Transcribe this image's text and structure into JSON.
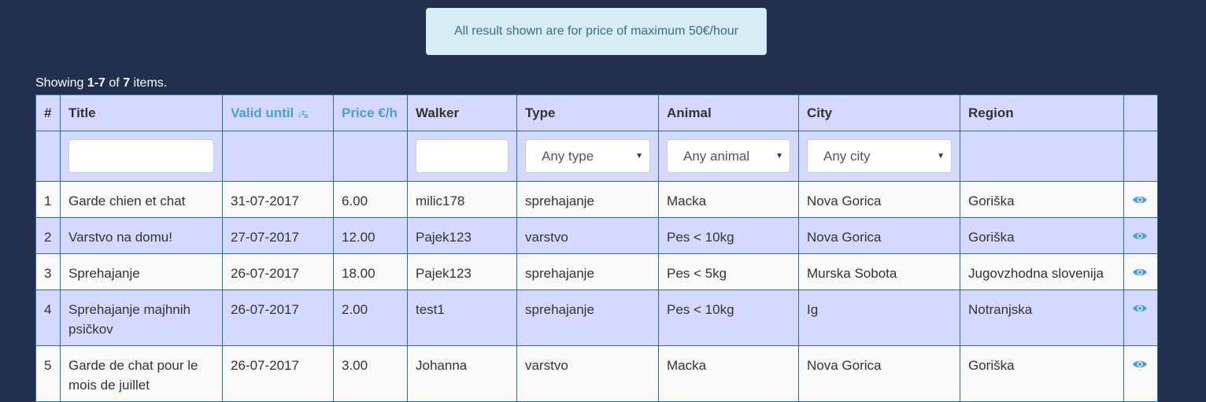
{
  "alert": {
    "text": "All result shown are for price of maximum 50€/hour"
  },
  "summary": {
    "prefix": "Showing ",
    "range": "1-7",
    "middle": " of ",
    "total": "7",
    "suffix": " items."
  },
  "columns": {
    "num": "#",
    "title": "Title",
    "valid_until": "Valid until",
    "price": "Price €/h",
    "walker": "Walker",
    "type": "Type",
    "animal": "Animal",
    "city": "City",
    "region": "Region"
  },
  "sort_icon": "sort-alpha-desc-icon",
  "filters": {
    "title_value": "",
    "walker_value": "",
    "type_selected": "Any type",
    "animal_selected": "Any animal",
    "city_selected": "Any city"
  },
  "rows": [
    {
      "num": "1",
      "title": "Garde chien et chat",
      "valid_until": "31-07-2017",
      "price": "6.00",
      "walker": "milic178",
      "type": "sprehajanje",
      "animal": "Macka",
      "city": "Nova Gorica",
      "region": "Goriška"
    },
    {
      "num": "2",
      "title": "Varstvo na domu!",
      "valid_until": "27-07-2017",
      "price": "12.00",
      "walker": "Pajek123",
      "type": "varstvo",
      "animal": "Pes < 10kg",
      "city": "Nova Gorica",
      "region": "Goriška"
    },
    {
      "num": "3",
      "title": "Sprehajanje",
      "valid_until": "26-07-2017",
      "price": "18.00",
      "walker": "Pajek123",
      "type": "sprehajanje",
      "animal": "Pes < 5kg",
      "city": "Murska Sobota",
      "region": "Jugovzhodna slovenija"
    },
    {
      "num": "4",
      "title": "Sprehajanje majhnih psičkov",
      "valid_until": "26-07-2017",
      "price": "2.00",
      "walker": "test1",
      "type": "sprehajanje",
      "animal": "Pes < 10kg",
      "city": "Ig",
      "region": "Notranjska"
    },
    {
      "num": "5",
      "title": "Garde de chat pour le mois de juillet",
      "valid_until": "26-07-2017",
      "price": "3.00",
      "walker": "Johanna",
      "type": "varstvo",
      "animal": "Macka",
      "city": "Nova Gorica",
      "region": "Goriška"
    }
  ],
  "colors": {
    "background": "#22304e",
    "row_alt": "#d6d9ff",
    "link": "#4a9fd5",
    "border": "#2b6e9e"
  }
}
